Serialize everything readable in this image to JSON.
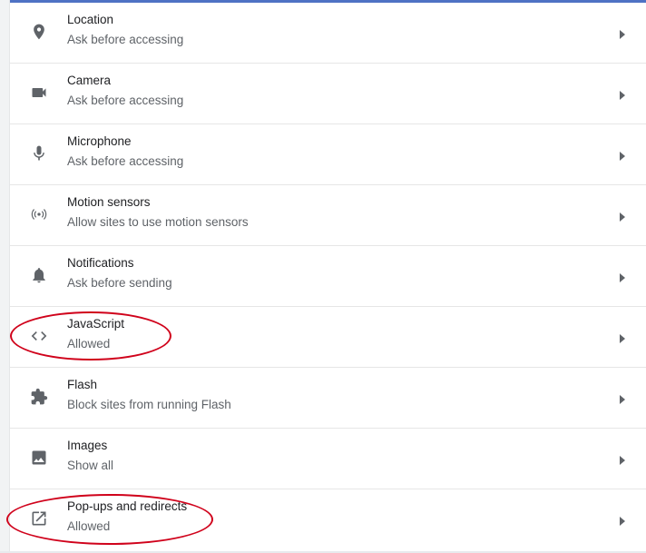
{
  "settings": [
    {
      "icon": "location-pin-icon",
      "label": "Location",
      "sub": "Ask before accessing"
    },
    {
      "icon": "camera-icon",
      "label": "Camera",
      "sub": "Ask before accessing"
    },
    {
      "icon": "microphone-icon",
      "label": "Microphone",
      "sub": "Ask before accessing"
    },
    {
      "icon": "motion-sensors-icon",
      "label": "Motion sensors",
      "sub": "Allow sites to use motion sensors"
    },
    {
      "icon": "bell-icon",
      "label": "Notifications",
      "sub": "Ask before sending"
    },
    {
      "icon": "code-icon",
      "label": "JavaScript",
      "sub": "Allowed"
    },
    {
      "icon": "puzzle-piece-icon",
      "label": "Flash",
      "sub": "Block sites from running Flash"
    },
    {
      "icon": "image-icon",
      "label": "Images",
      "sub": "Show all"
    },
    {
      "icon": "open-in-new-icon",
      "label": "Pop-ups and redirects",
      "sub": "Allowed"
    }
  ],
  "colors": {
    "accent_bar": "#4f72c4",
    "highlight": "#d0021b",
    "text_primary": "#202124",
    "text_secondary": "#5f6368"
  }
}
